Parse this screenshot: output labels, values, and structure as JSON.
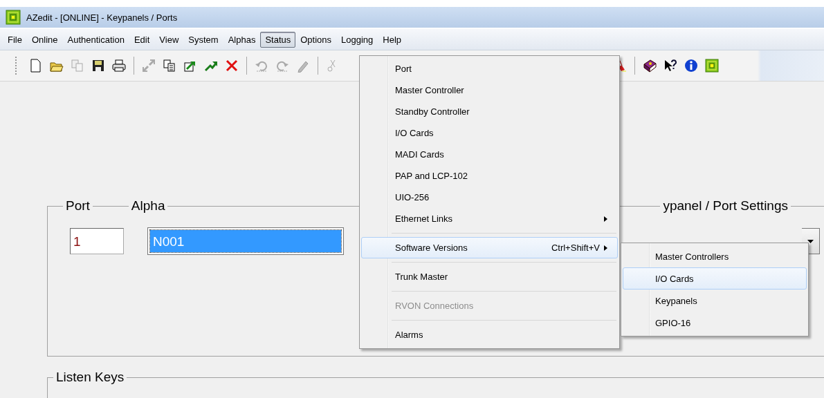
{
  "window": {
    "title": "AZedit - [ONLINE] - Keypanels / Ports"
  },
  "menu_bar": [
    {
      "label": "File",
      "selected": false
    },
    {
      "label": "Online",
      "selected": false
    },
    {
      "label": "Authentication",
      "selected": false
    },
    {
      "label": "Edit",
      "selected": false
    },
    {
      "label": "View",
      "selected": false
    },
    {
      "label": "System",
      "selected": false
    },
    {
      "label": "Alphas",
      "selected": false
    },
    {
      "label": "Status",
      "selected": true
    },
    {
      "label": "Options",
      "selected": false
    },
    {
      "label": "Logging",
      "selected": false
    },
    {
      "label": "Help",
      "selected": false
    }
  ],
  "status_menu": {
    "items": [
      {
        "kind": "item",
        "label": "Port",
        "highlighted": false,
        "disabled": false,
        "submenu": false
      },
      {
        "kind": "item",
        "label": "Master Controller",
        "highlighted": false,
        "disabled": false,
        "submenu": false
      },
      {
        "kind": "item",
        "label": "Standby Controller",
        "highlighted": false,
        "disabled": false,
        "submenu": false
      },
      {
        "kind": "item",
        "label": "I/O Cards",
        "highlighted": false,
        "disabled": false,
        "submenu": false
      },
      {
        "kind": "item",
        "label": "MADI Cards",
        "highlighted": false,
        "disabled": false,
        "submenu": false
      },
      {
        "kind": "item",
        "label": "PAP and LCP-102",
        "highlighted": false,
        "disabled": false,
        "submenu": false
      },
      {
        "kind": "item",
        "label": "UIO-256",
        "highlighted": false,
        "disabled": false,
        "submenu": false
      },
      {
        "kind": "item",
        "label": "Ethernet Links",
        "highlighted": false,
        "disabled": false,
        "submenu": true
      },
      {
        "kind": "separator"
      },
      {
        "kind": "item",
        "label": "Software Versions",
        "shortcut": "Ctrl+Shift+V",
        "highlighted": true,
        "disabled": false,
        "submenu": true
      },
      {
        "kind": "separator"
      },
      {
        "kind": "item",
        "label": "Trunk Master",
        "highlighted": false,
        "disabled": false,
        "submenu": false
      },
      {
        "kind": "separator"
      },
      {
        "kind": "item",
        "label": "RVON Connections",
        "highlighted": false,
        "disabled": true,
        "submenu": false
      },
      {
        "kind": "separator"
      },
      {
        "kind": "item",
        "label": "Alarms",
        "highlighted": false,
        "disabled": false,
        "submenu": false
      }
    ]
  },
  "software_versions_menu": {
    "items": [
      {
        "label": "Master Controllers",
        "highlighted": false
      },
      {
        "label": "I/O Cards",
        "highlighted": true
      },
      {
        "label": "Keypanels",
        "highlighted": false
      },
      {
        "label": "GPIO-16",
        "highlighted": false
      }
    ]
  },
  "port_group": {
    "port_label": "Port",
    "alpha_label": "Alpha",
    "port_value": "1",
    "alpha_value": "N001",
    "alpha_selected": true
  },
  "settings_group": {
    "label": "ypanel / Port Settings"
  },
  "listen_keys_group": {
    "label": "Listen Keys"
  }
}
